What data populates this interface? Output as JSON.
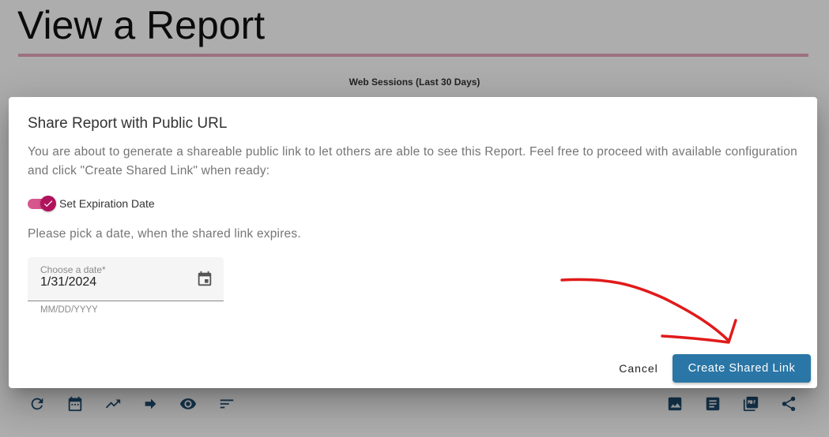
{
  "page": {
    "title": "View a Report",
    "chart_title": "Web Sessions (Last 30 Days)"
  },
  "toolbar": {
    "left_icons": [
      "refresh-icon",
      "calendar-icon",
      "trending-up-icon",
      "arrow-forward-icon",
      "visibility-icon",
      "sort-icon"
    ],
    "right_icons": [
      "image-icon",
      "document-icon",
      "pdf-icon",
      "share-icon"
    ]
  },
  "dialog": {
    "title": "Share Report with Public URL",
    "description": "You are about to generate a shareable public link to let others are able to see this Report. Feel free to proceed with available configuration and click \"Create Shared Link\" when ready:",
    "toggle": {
      "label": "Set Expiration Date",
      "checked": true
    },
    "hint": "Please pick a date, when the shared link expires.",
    "date_field": {
      "label": "Choose a date*",
      "value": "1/31/2024",
      "format_hint": "MM/DD/YYYY"
    },
    "cancel_label": "Cancel",
    "create_label": "Create Shared Link"
  },
  "colors": {
    "accent": "#b0135c",
    "primary_button": "#2a76a6",
    "toolbar_icon": "#1f4f74",
    "annotation": "#e01b1b"
  }
}
